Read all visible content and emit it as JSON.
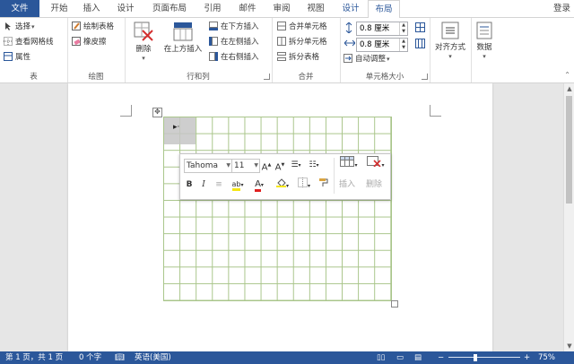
{
  "tabs": [
    "文件",
    "开始",
    "插入",
    "设计",
    "页面布局",
    "引用",
    "邮件",
    "审阅",
    "视图",
    "设计",
    "布局"
  ],
  "signin": "登录",
  "ribbon": {
    "table_group": {
      "select": "选择",
      "view_gridlines": "查看网格线",
      "properties": "属性",
      "label": "表"
    },
    "draw_group": {
      "draw_table": "绘制表格",
      "eraser": "橡皮擦",
      "label": "绘图"
    },
    "rowcol_group": {
      "delete": "删除",
      "insert_above": "在上方插入",
      "insert_below": "在下方插入",
      "insert_left": "在左侧插入",
      "insert_right": "在右侧插入",
      "label": "行和列"
    },
    "merge_group": {
      "merge_cells": "合并单元格",
      "split_cells": "拆分单元格",
      "split_table": "拆分表格",
      "label": "合并"
    },
    "cellsize_group": {
      "height_value": "0.8 厘米",
      "width_value": "0.8 厘米",
      "autofit": "自动调整",
      "label": "单元格大小"
    },
    "alignment": "对齐方式",
    "data": "数据"
  },
  "minibar": {
    "font_name": "Tahoma",
    "font_size": "11",
    "insert": "插入",
    "delete": "删除",
    "bold": "B",
    "italic": "I"
  },
  "status": {
    "page": "第 1 页，共 1 页",
    "words": "0 个字",
    "language": "英语(美国)",
    "zoom": "75%",
    "zoom_level": 0.75
  },
  "colors": {
    "brand": "#2b579a",
    "grid": "#a9c58a",
    "font_color_red": "#e02020",
    "highlight_yellow": "#f5e614"
  }
}
